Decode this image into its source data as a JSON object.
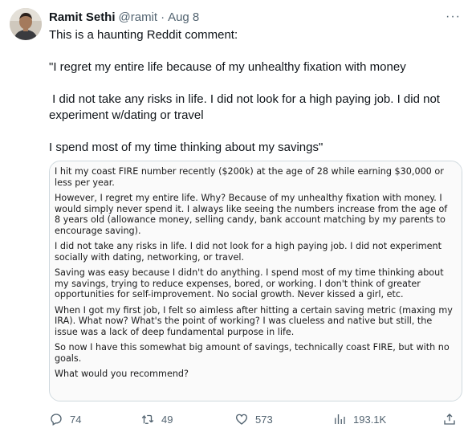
{
  "author": {
    "display_name": "Ramit Sethi",
    "handle": "@ramit",
    "separator": "·",
    "time": "Aug 8",
    "more_label": "···"
  },
  "tweet": {
    "line1": "This is a haunting Reddit comment:",
    "line2": "\"I regret my entire life because of my unhealthy fixation with money",
    "line3": " I did not take any risks in life. I did not look for a high paying job. I did not experiment w/dating or travel",
    "line4": "I spend most of my time thinking about my savings\""
  },
  "reddit_comment": {
    "p1": "I hit my coast FIRE number recently ($200k) at the age of 28 while earning $30,000 or less per year.",
    "p2": "However, I regret my entire life. Why? Because of my unhealthy fixation with money. I would simply never spend it. I always like seeing the numbers increase from the age of 8 years old (allowance money, selling candy, bank account matching by my parents to encourage saving).",
    "p3": "I did not take any risks in life. I did not look for a high paying job. I did not experiment socially with dating, networking, or travel.",
    "p4": "Saving was easy because I didn't do anything. I spend most of my time thinking about my savings, trying to reduce expenses, bored, or working. I don't think of greater opportunities for self-improvement. No social growth. Never kissed a girl, etc.",
    "p5": "When I got my first job, I felt so aimless after hitting a certain saving metric (maxing my IRA). What now? What's the point of working? I was clueless and native but still, the issue was a lack of deep fundamental purpose in life.",
    "p6": "So now I have this somewhat big amount of savings, technically coast FIRE, but with no goals.",
    "p7": "What would you recommend?"
  },
  "actions": {
    "replies": "74",
    "retweets": "49",
    "likes": "573",
    "views": "193.1K"
  },
  "icons": {
    "reply": "speech-bubble-icon",
    "retweet": "retweet-arrows-icon",
    "like": "heart-icon",
    "views": "bar-chart-icon",
    "share": "share-upload-icon"
  },
  "colors": {
    "text": "#0f1419",
    "secondary": "#536471",
    "border": "#cfd9de"
  }
}
